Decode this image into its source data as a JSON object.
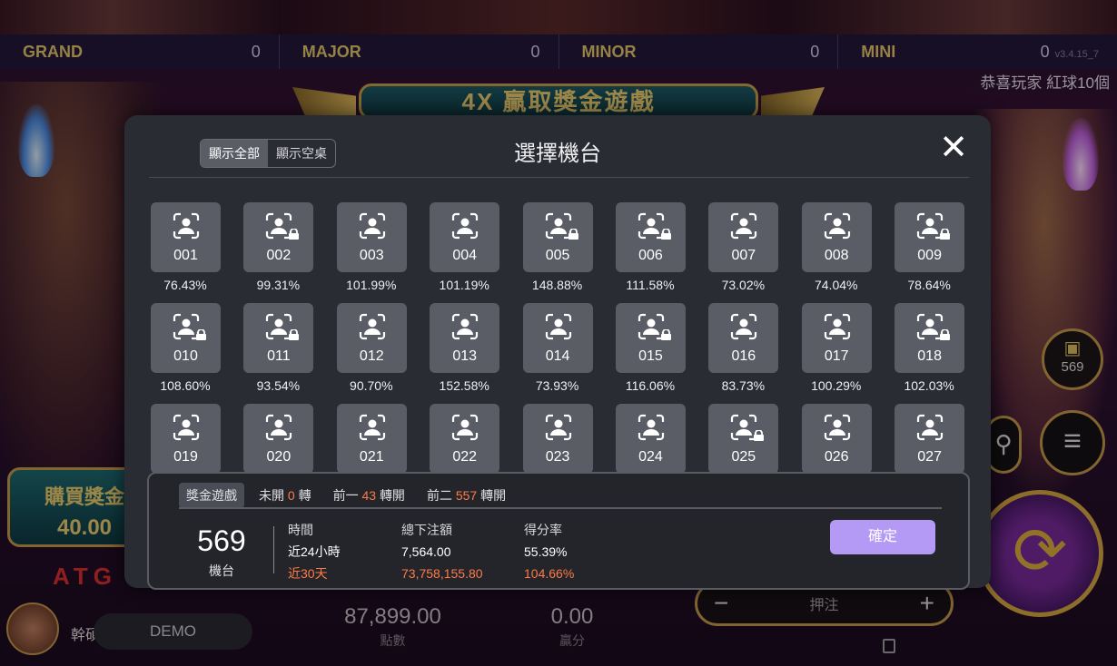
{
  "jackpots": [
    {
      "name": "GRAND",
      "value": "0"
    },
    {
      "name": "MAJOR",
      "value": "0"
    },
    {
      "name": "MINOR",
      "value": "0"
    },
    {
      "name": "MINI",
      "value": "0"
    }
  ],
  "version": "v3.4.15_7",
  "marquee": "恭喜玩家 紅球10個",
  "banner": "4X 贏取獎金遊戲",
  "buy_bonus": {
    "label": "購買獎金",
    "value": "40.00"
  },
  "logo": "ATG",
  "machine_count_badge": "569",
  "bet_label": "押注",
  "player_name": "幹碩",
  "demo_label": "DEMO",
  "balance": {
    "value": "87,899.00",
    "label": "點數"
  },
  "win": {
    "value": "0.00",
    "label": "贏分"
  },
  "modal": {
    "title": "選擇機台",
    "filter_all": "顯示全部",
    "filter_empty": "顯示空桌",
    "machines": [
      {
        "id": "001",
        "rate": "76.43%",
        "locked": false
      },
      {
        "id": "002",
        "rate": "99.31%",
        "locked": true
      },
      {
        "id": "003",
        "rate": "101.99%",
        "locked": false
      },
      {
        "id": "004",
        "rate": "101.19%",
        "locked": false
      },
      {
        "id": "005",
        "rate": "148.88%",
        "locked": true
      },
      {
        "id": "006",
        "rate": "111.58%",
        "locked": true
      },
      {
        "id": "007",
        "rate": "73.02%",
        "locked": false
      },
      {
        "id": "008",
        "rate": "74.04%",
        "locked": false
      },
      {
        "id": "009",
        "rate": "78.64%",
        "locked": true
      },
      {
        "id": "010",
        "rate": "108.60%",
        "locked": true
      },
      {
        "id": "011",
        "rate": "93.54%",
        "locked": true
      },
      {
        "id": "012",
        "rate": "90.70%",
        "locked": false
      },
      {
        "id": "013",
        "rate": "152.58%",
        "locked": false
      },
      {
        "id": "014",
        "rate": "73.93%",
        "locked": false
      },
      {
        "id": "015",
        "rate": "116.06%",
        "locked": true
      },
      {
        "id": "016",
        "rate": "83.73%",
        "locked": false
      },
      {
        "id": "017",
        "rate": "100.29%",
        "locked": false
      },
      {
        "id": "018",
        "rate": "102.03%",
        "locked": true
      },
      {
        "id": "019",
        "rate": "",
        "locked": false
      },
      {
        "id": "020",
        "rate": "",
        "locked": false
      },
      {
        "id": "021",
        "rate": "",
        "locked": false
      },
      {
        "id": "022",
        "rate": "",
        "locked": false
      },
      {
        "id": "023",
        "rate": "",
        "locked": false
      },
      {
        "id": "024",
        "rate": "",
        "locked": false
      },
      {
        "id": "025",
        "rate": "",
        "locked": true
      },
      {
        "id": "026",
        "rate": "",
        "locked": false
      },
      {
        "id": "027",
        "rate": "",
        "locked": false
      }
    ],
    "panel": {
      "tab": "獎金遊戲",
      "not_open_label": "未開",
      "not_open_value": "0",
      "not_open_unit": "轉",
      "prev1_label": "前一",
      "prev1_value": "43",
      "prev1_unit": "轉開",
      "prev2_label": "前二",
      "prev2_value": "557",
      "prev2_unit": "轉開",
      "machine_no": "569",
      "machine_label": "機台",
      "time_header": "時間",
      "bet_header": "總下注額",
      "rate_header": "得分率",
      "row1_time": "近24小時",
      "row1_bet": "7,564.00",
      "row1_rate": "55.39%",
      "row2_time": "近30天",
      "row2_bet": "73,758,155.80",
      "row2_rate": "104.66%",
      "confirm": "確定"
    }
  }
}
